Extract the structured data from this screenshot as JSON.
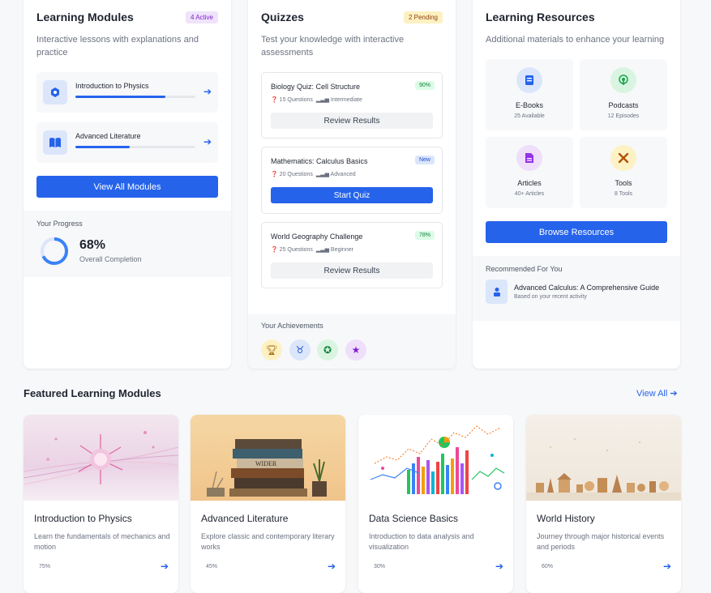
{
  "learning_modules": {
    "title": "Learning Modules",
    "badge": "4 Active",
    "description": "Interactive lessons with explanations and practice",
    "modules": [
      {
        "label": "Introduction to Physics",
        "progress": 0.75
      },
      {
        "label": "Advanced Literature",
        "progress": 0.45
      }
    ],
    "view_all_label": "View All Modules",
    "progress_label": "Your Progress",
    "progress_value": "68%",
    "progress_fraction": 0.68,
    "progress_caption": "Overall Completion"
  },
  "quizzes": {
    "title": "Quizzes",
    "badge": "2 Pending",
    "description": "Test your knowledge with interactive assessments",
    "items": [
      {
        "title": "Biology Quiz: Cell Structure",
        "tag": "90%",
        "questions": "15 Questions",
        "level": "Intermediate",
        "button": "Review Results"
      },
      {
        "title": "Mathematics: Calculus Basics",
        "tag": "New",
        "questions": "20 Questions",
        "level": "Advanced",
        "button": "Start Quiz"
      },
      {
        "title": "World Geography Challenge",
        "tag": "78%",
        "questions": "25 Questions",
        "level": "Beginner",
        "button": "Review Results"
      }
    ],
    "achievements_label": "Your Achievements",
    "achievements": [
      "trophy-icon",
      "medal-icon",
      "award-icon",
      "star-icon"
    ]
  },
  "resources": {
    "title": "Learning Resources",
    "description": "Additional materials to enhance your learning",
    "tiles": [
      {
        "name": "E-Books",
        "sub": "25 Available",
        "icon": "book-icon",
        "color": "#2563eb",
        "bg": "#dbe6fb"
      },
      {
        "name": "Podcasts",
        "sub": "12 Episodes",
        "icon": "podcast-icon",
        "color": "#16a34a",
        "bg": "#d9f5e1"
      },
      {
        "name": "Articles",
        "sub": "40+ Articles",
        "icon": "article-icon",
        "color": "#9333ea",
        "bg": "#efdffb"
      },
      {
        "name": "Tools",
        "sub": "8 Tools",
        "icon": "tools-icon",
        "color": "#b45309",
        "bg": "#fdf2c4"
      }
    ],
    "browse_label": "Browse Resources",
    "recommended_label": "Recommended For You",
    "recommended_title": "Advanced Calculus: A Comprehensive Guide",
    "recommended_sub": "Based on your recent activity"
  },
  "featured": {
    "title": "Featured Learning Modules",
    "view_all": "View All",
    "cards": [
      {
        "title": "Introduction to Physics",
        "desc": "Learn the fundamentals of mechanics and motion",
        "pct": "75%"
      },
      {
        "title": "Advanced Literature",
        "desc": "Explore classic and contemporary literary works",
        "pct": "45%",
        "book_text": "WIDER"
      },
      {
        "title": "Data Science Basics",
        "desc": "Introduction to data analysis and visualization",
        "pct": "30%"
      },
      {
        "title": "World History",
        "desc": "Journey through major historical events and periods",
        "pct": "60%"
      }
    ]
  },
  "colors": {
    "accent": "#2563eb",
    "green": "#16a34a",
    "purple": "#9333ea"
  }
}
